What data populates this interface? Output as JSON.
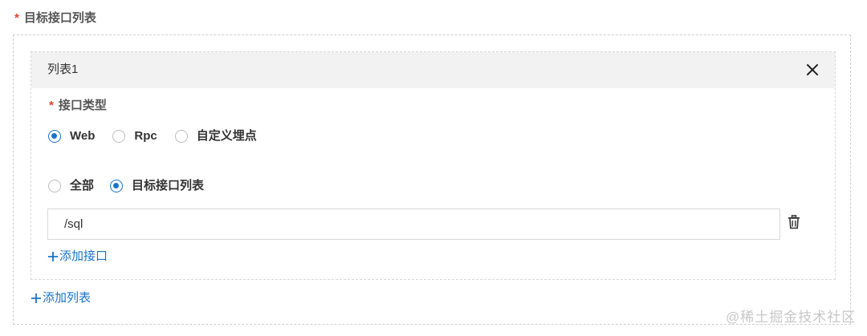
{
  "field": {
    "required_mark": "*",
    "label": "目标接口列表"
  },
  "card": {
    "title": "列表1",
    "close_icon": "close-icon",
    "type_field": {
      "required_mark": "*",
      "label": "接口类型",
      "options": [
        "Web",
        "Rpc",
        "自定义埋点"
      ],
      "selected": "Web"
    },
    "scope_field": {
      "options": [
        "全部",
        "目标接口列表"
      ],
      "selected": "目标接口列表"
    },
    "path_input": {
      "value": "/sql",
      "delete_icon": "trash-icon"
    },
    "add_api_label": "添加接口"
  },
  "add_list_label": "添加列表",
  "watermark": "@稀土掘金技术社区",
  "colors": {
    "accent": "#1a73c8",
    "required": "#e0432f",
    "header_bg": "#f2f2f2"
  }
}
